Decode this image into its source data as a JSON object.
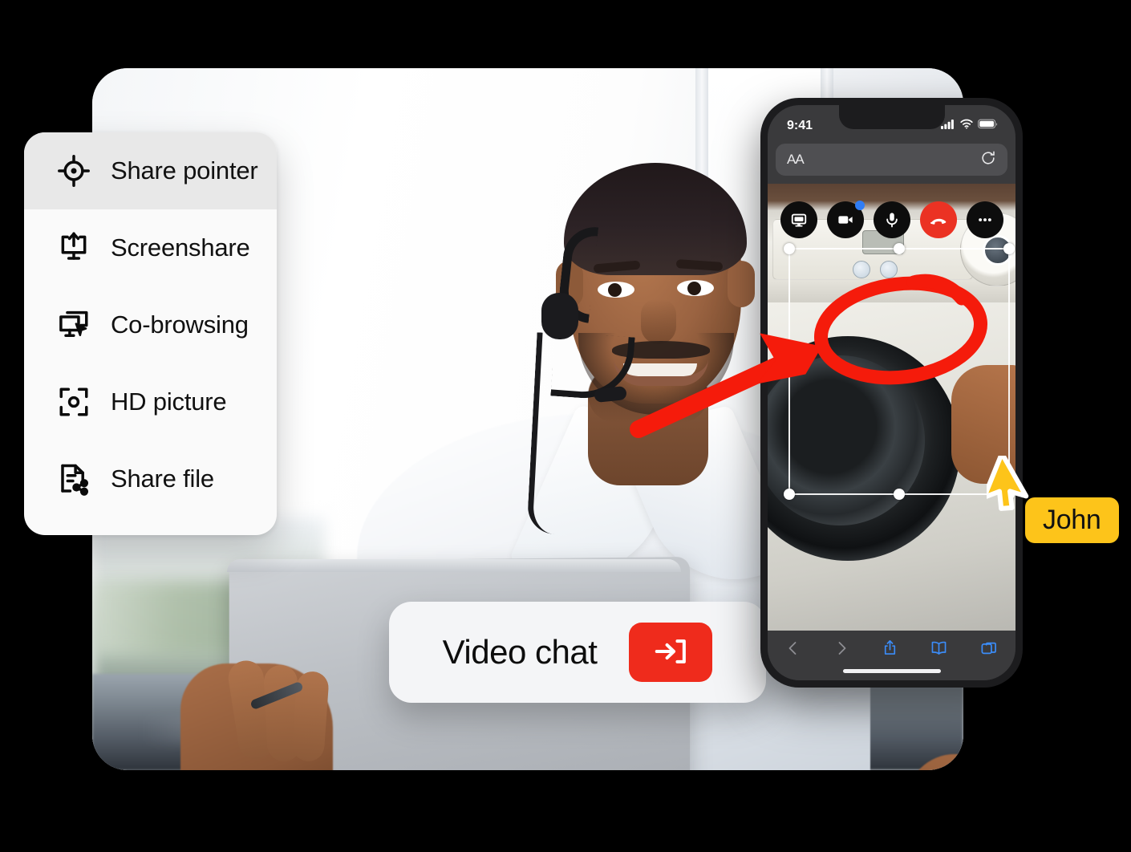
{
  "menu": {
    "items": [
      {
        "label": "Share pointer",
        "icon": "share-pointer-icon",
        "active": true
      },
      {
        "label": "Screenshare",
        "icon": "screenshare-icon",
        "active": false
      },
      {
        "label": "Co-browsing",
        "icon": "co-browsing-icon",
        "active": false
      },
      {
        "label": "HD picture",
        "icon": "hd-picture-icon",
        "active": false
      },
      {
        "label": "Share file",
        "icon": "share-file-icon",
        "active": false
      }
    ]
  },
  "video_chat": {
    "label": "Video chat",
    "button_icon": "enter-arrow-icon",
    "button_color": "#EF2B1C"
  },
  "phone": {
    "status_bar": {
      "time": "9:41",
      "signal_icon": "cellular-signal-icon",
      "wifi_icon": "wifi-icon",
      "battery_icon": "battery-icon"
    },
    "browser": {
      "text_size_label": "AA",
      "reload_icon": "reload-icon",
      "toolbar": [
        {
          "icon": "back-chevron-icon",
          "label": "Back",
          "enabled": false
        },
        {
          "icon": "forward-chevron-icon",
          "label": "Forward",
          "enabled": false
        },
        {
          "icon": "share-icon",
          "label": "Share",
          "enabled": true
        },
        {
          "icon": "bookmarks-icon",
          "label": "Bookmarks",
          "enabled": true
        },
        {
          "icon": "tabs-icon",
          "label": "Tabs",
          "enabled": true
        }
      ]
    },
    "call_controls": [
      {
        "icon": "screen-share-icon",
        "label": "Share screen",
        "style": "dark",
        "badge": false
      },
      {
        "icon": "video-camera-icon",
        "label": "Camera",
        "style": "dark",
        "badge": true
      },
      {
        "icon": "microphone-icon",
        "label": "Microphone",
        "style": "dark",
        "badge": false
      },
      {
        "icon": "end-call-icon",
        "label": "End call",
        "style": "red",
        "badge": false
      },
      {
        "icon": "more-options-icon",
        "label": "More",
        "style": "dark",
        "badge": false
      }
    ],
    "annotations": {
      "ellipse_color": "#F51B0B",
      "arrow_color": "#F51B0B",
      "selection_handles": 8
    }
  },
  "remote_pointer": {
    "name": "John",
    "cursor_color": "#FDC41A",
    "label_bg": "#FDC41A",
    "label_text_color": "#111111"
  }
}
